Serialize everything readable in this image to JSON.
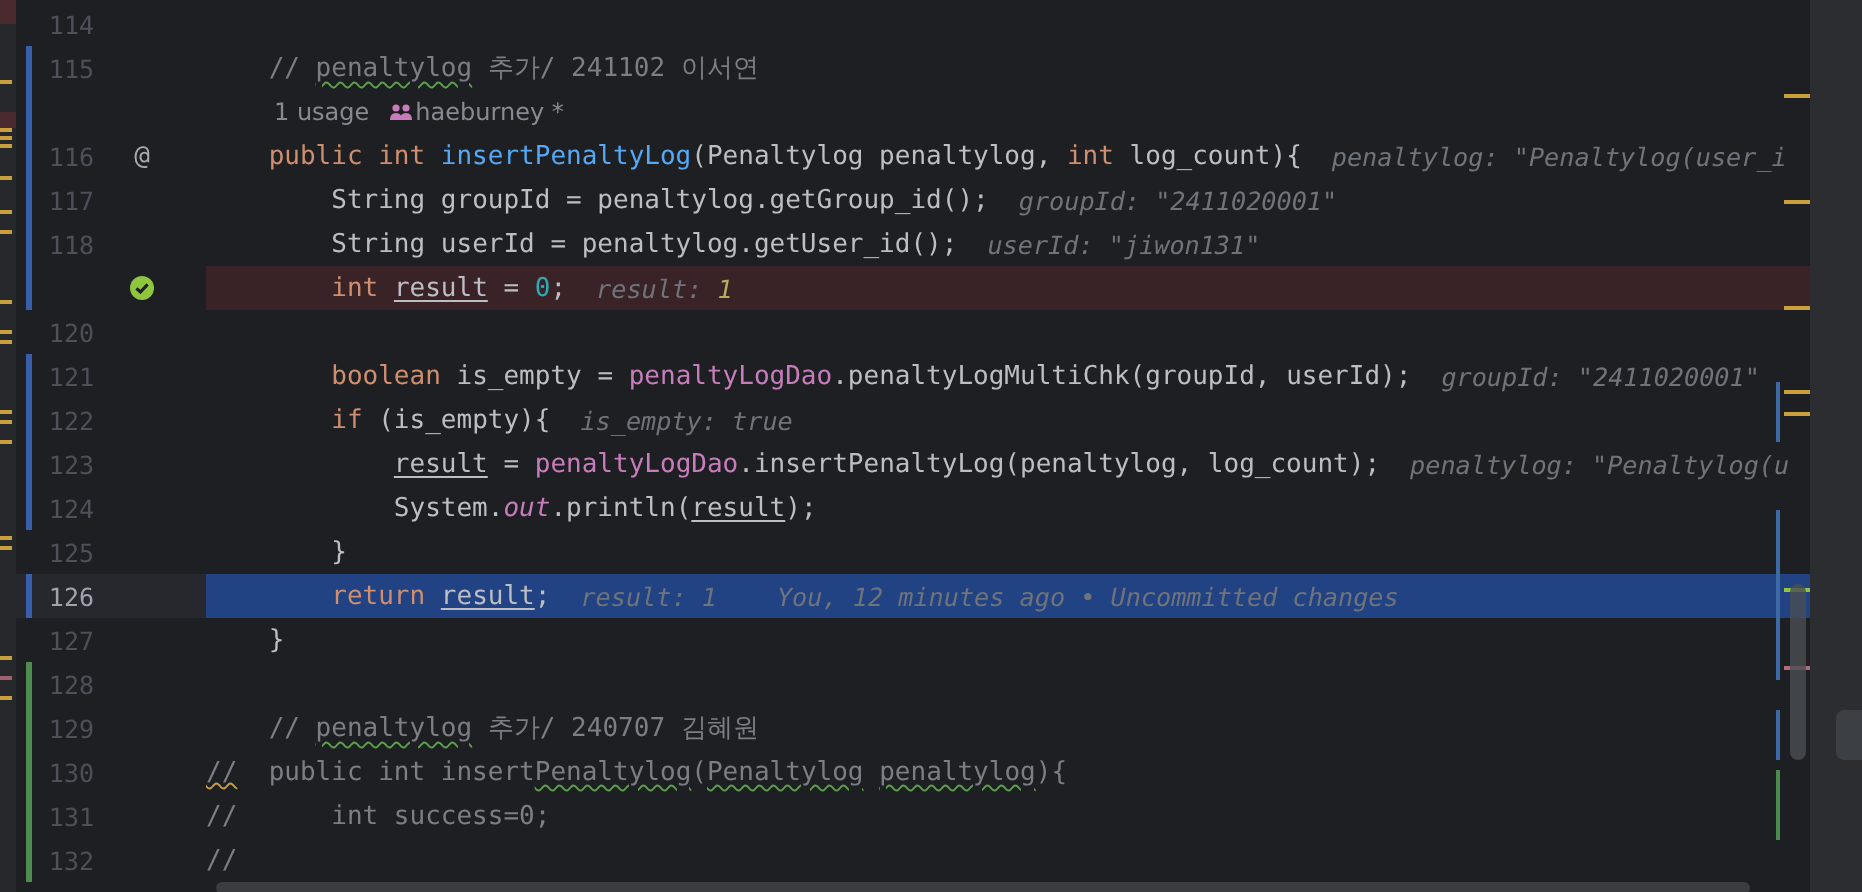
{
  "editor": {
    "lines": [
      {
        "kind": "code",
        "number": "114",
        "modified": false,
        "added": false,
        "breakpoint": false,
        "current": false
      },
      {
        "kind": "code",
        "number": "115",
        "modified": true,
        "added": false,
        "breakpoint": false,
        "current": false,
        "tokens": [
          {
            "kind": "comment",
            "text": "    // "
          },
          {
            "kind": "typo",
            "text": "penaltylog"
          },
          {
            "kind": "comment",
            "text": " 추가/ 241102 이서연"
          }
        ]
      },
      {
        "kind": "usage",
        "modified": true,
        "added": false,
        "breakpoint": false,
        "current": false,
        "usages": "1 usage",
        "author": "haeburney *"
      },
      {
        "kind": "code",
        "number": "116",
        "modified": true,
        "added": false,
        "breakpoint": false,
        "current": false,
        "gutter_text": "@",
        "tokens": [
          {
            "kind": "keyword",
            "text": "    public int "
          },
          {
            "kind": "method",
            "text": "insertPenaltyLog"
          },
          {
            "kind": "plain",
            "text": "(Penaltylog penaltylog, "
          },
          {
            "kind": "keyword",
            "text": "int"
          },
          {
            "kind": "plain",
            "text": " log_count){"
          }
        ],
        "hint": [
          {
            "kind": "plain",
            "text": "penaltylog: \"Penaltylog(user_i"
          }
        ]
      },
      {
        "kind": "code",
        "number": "117",
        "modified": true,
        "added": false,
        "breakpoint": false,
        "current": false,
        "tokens": [
          {
            "kind": "plain",
            "text": "        String groupId = penaltylog.getGroup_id();"
          }
        ],
        "hint": [
          {
            "kind": "plain",
            "text": "groupId: \"2411020001\""
          }
        ]
      },
      {
        "kind": "code",
        "number": "118",
        "modified": true,
        "added": false,
        "breakpoint": false,
        "current": false,
        "tokens": [
          {
            "kind": "plain",
            "text": "        String userId = penaltylog.getUser_id();"
          }
        ],
        "hint": [
          {
            "kind": "plain",
            "text": "userId: \"jiwon131\""
          }
        ]
      },
      {
        "kind": "code",
        "modified": true,
        "added": false,
        "breakpoint": true,
        "current": false,
        "breakpoint_verified": true,
        "tokens": [
          {
            "kind": "keyword",
            "text": "        int "
          },
          {
            "kind": "reassigned",
            "text": "result"
          },
          {
            "kind": "plain",
            "text": " = "
          },
          {
            "kind": "number",
            "text": "0"
          },
          {
            "kind": "plain",
            "text": ";"
          }
        ],
        "hint": [
          {
            "kind": "plain",
            "text": "result: "
          },
          {
            "kind": "value",
            "text": "1"
          }
        ]
      },
      {
        "kind": "code",
        "number": "120",
        "modified": false,
        "added": false,
        "breakpoint": false,
        "current": false
      },
      {
        "kind": "code",
        "number": "121",
        "modified": true,
        "added": false,
        "breakpoint": false,
        "current": false,
        "tokens": [
          {
            "kind": "keyword",
            "text": "        boolean"
          },
          {
            "kind": "plain",
            "text": " is_empty = "
          },
          {
            "kind": "field",
            "text": "penaltyLogDao"
          },
          {
            "kind": "plain",
            "text": ".penaltyLogMultiChk(groupId, userId);"
          }
        ],
        "hint": [
          {
            "kind": "plain",
            "text": "groupId: \"2411020001\""
          }
        ]
      },
      {
        "kind": "code",
        "number": "122",
        "modified": true,
        "added": false,
        "breakpoint": false,
        "current": false,
        "tokens": [
          {
            "kind": "keyword",
            "text": "        if"
          },
          {
            "kind": "plain",
            "text": " (is_empty){"
          }
        ],
        "hint": [
          {
            "kind": "plain",
            "text": "is_empty: true"
          }
        ]
      },
      {
        "kind": "code",
        "number": "123",
        "modified": true,
        "added": false,
        "breakpoint": false,
        "current": false,
        "tokens": [
          {
            "kind": "reassigned",
            "text": "            result"
          },
          {
            "kind": "plain",
            "text": " = "
          },
          {
            "kind": "field",
            "text": "penaltyLogDao"
          },
          {
            "kind": "plain",
            "text": ".insertPenaltyLog(penaltylog, log_count);"
          }
        ],
        "hint": [
          {
            "kind": "plain",
            "text": "penaltylog: \"Penaltylog(u"
          }
        ]
      },
      {
        "kind": "code",
        "number": "124",
        "modified": true,
        "added": false,
        "breakpoint": false,
        "current": false,
        "tokens": [
          {
            "kind": "plain",
            "text": "            System."
          },
          {
            "kind": "static",
            "text": "out"
          },
          {
            "kind": "plain",
            "text": ".println("
          },
          {
            "kind": "reassigned",
            "text": "result"
          },
          {
            "kind": "plain",
            "text": ");"
          }
        ]
      },
      {
        "kind": "code",
        "number": "125",
        "modified": false,
        "added": false,
        "breakpoint": false,
        "current": false,
        "tokens": [
          {
            "kind": "plain",
            "text": "        }"
          }
        ]
      },
      {
        "kind": "code",
        "number": "126",
        "modified": true,
        "added": false,
        "breakpoint": false,
        "current": true,
        "tokens": [
          {
            "kind": "keyword",
            "text": "        return "
          },
          {
            "kind": "reassigned",
            "text": "result"
          },
          {
            "kind": "plain",
            "text": ";"
          }
        ],
        "hint": [
          {
            "kind": "plain",
            "text": "result: 1"
          }
        ],
        "blame": "You, 12 minutes ago • Uncommitted changes"
      },
      {
        "kind": "code",
        "number": "127",
        "modified": false,
        "added": false,
        "breakpoint": false,
        "current": false,
        "tokens": [
          {
            "kind": "plain",
            "text": "    }"
          }
        ]
      },
      {
        "kind": "code",
        "number": "128",
        "modified": false,
        "added": true,
        "breakpoint": false,
        "current": false
      },
      {
        "kind": "code",
        "number": "129",
        "modified": false,
        "added": true,
        "breakpoint": false,
        "current": false,
        "tokens": [
          {
            "kind": "comment",
            "text": "    // "
          },
          {
            "kind": "typo",
            "text": "penaltylog"
          },
          {
            "kind": "comment",
            "text": " 추가/ 240707 김혜원"
          }
        ]
      },
      {
        "kind": "code",
        "number": "130",
        "modified": false,
        "added": true,
        "breakpoint": false,
        "current": false,
        "tokens": [
          {
            "kind": "warning",
            "text": "//"
          },
          {
            "kind": "comment",
            "text": "  public int insert"
          },
          {
            "kind": "typo",
            "text": "Penaltylog"
          },
          {
            "kind": "comment",
            "text": "("
          },
          {
            "kind": "typo",
            "text": "Penaltylog"
          },
          {
            "kind": "typo",
            "text": " penaltylog"
          },
          {
            "kind": "comment",
            "text": "){"
          }
        ]
      },
      {
        "kind": "code",
        "number": "131",
        "modified": false,
        "added": true,
        "breakpoint": false,
        "current": false,
        "tokens": [
          {
            "kind": "comment",
            "text": "//      int success=0;"
          }
        ]
      },
      {
        "kind": "code",
        "number": "132",
        "modified": false,
        "added": true,
        "breakpoint": false,
        "current": false,
        "tokens": [
          {
            "kind": "comment",
            "text": "//"
          }
        ]
      }
    ]
  }
}
